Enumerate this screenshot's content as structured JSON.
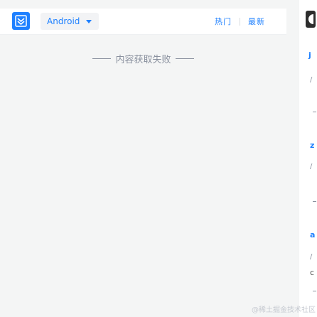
{
  "topbar": {
    "tag_label": "Android",
    "sort_tabs": [
      "热门",
      "最新"
    ]
  },
  "content": {
    "fail_message": "内容获取失败"
  },
  "right_strip": {
    "fragments": [
      "j",
      "/",
      "z",
      "/",
      "a",
      "/",
      "c"
    ]
  },
  "watermark": "@稀土掘金技术社区",
  "colors": {
    "accent": "#1e80ff",
    "muted": "#8a919f",
    "background": "#f4f5f5"
  }
}
